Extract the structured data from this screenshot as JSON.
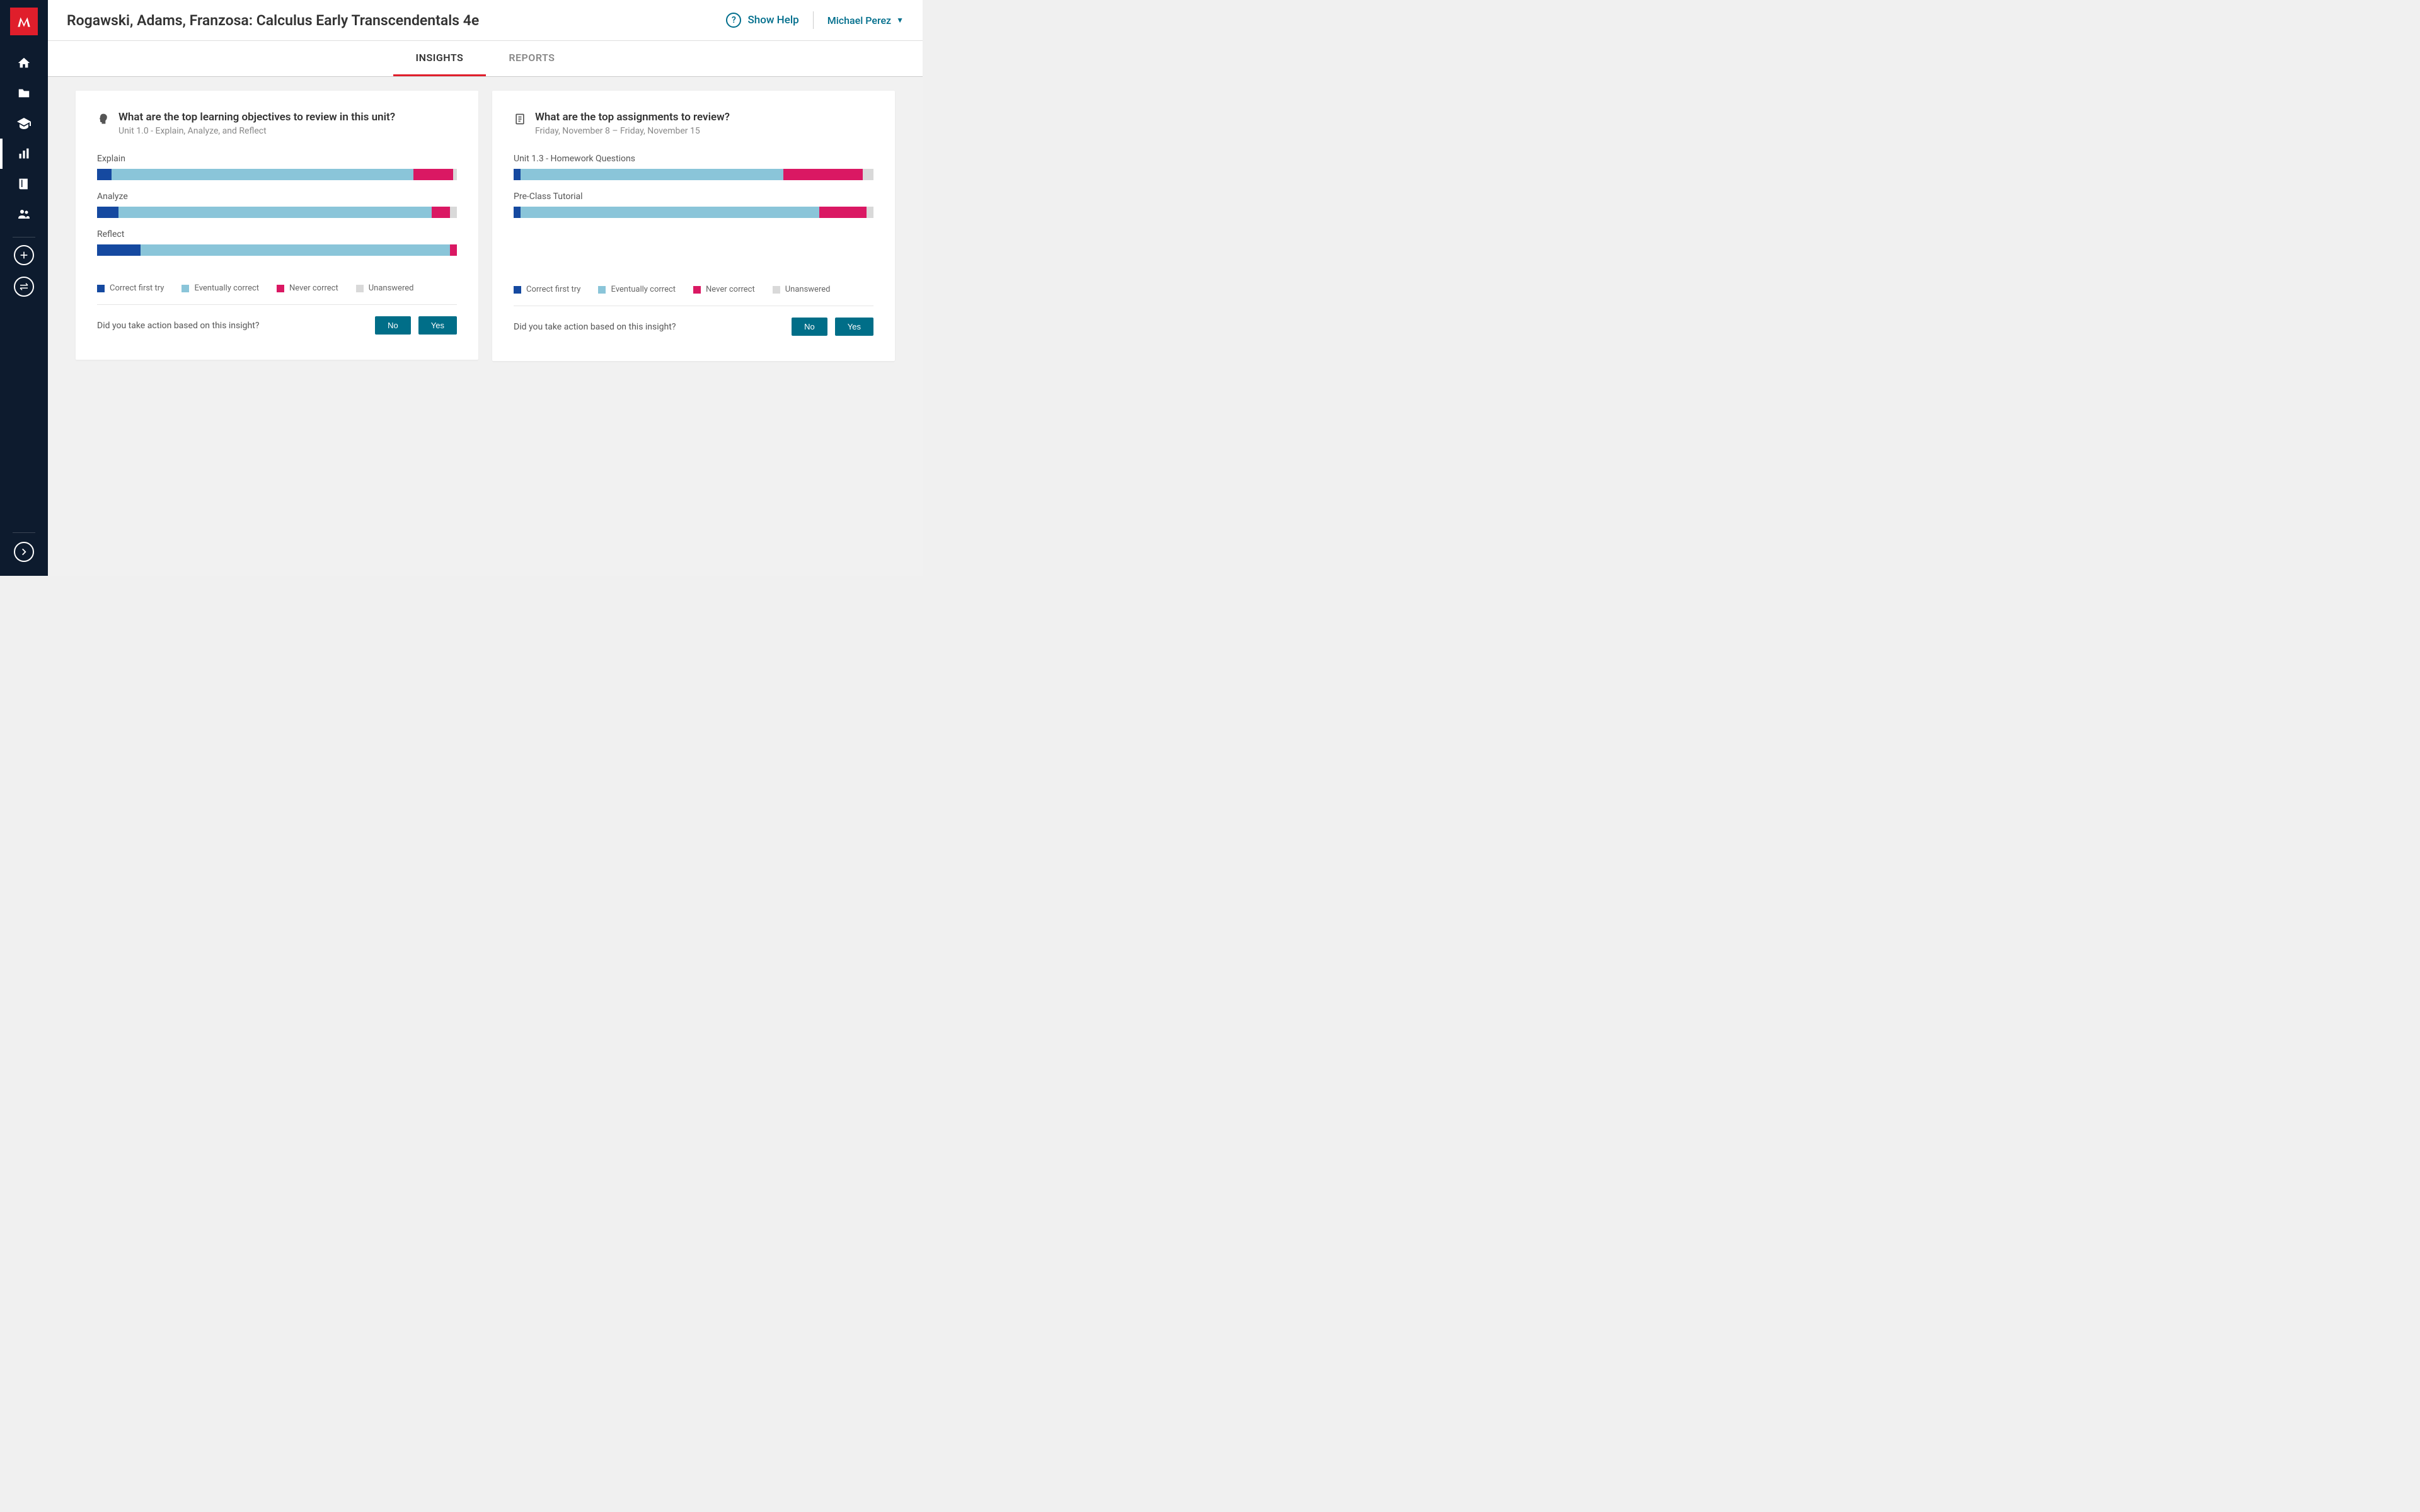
{
  "header": {
    "title": "Rogawski, Adams, Franzosa: Calculus Early Transcendentals 4e",
    "help_label": "Show Help",
    "user_name": "Michael Perez"
  },
  "tabs": {
    "insights": "INSIGHTS",
    "reports": "REPORTS"
  },
  "legend": {
    "correct": "Correct first try",
    "eventually": "Eventually correct",
    "never": "Never correct",
    "unanswered": "Unanswered"
  },
  "feedback": {
    "prompt": "Did you take action based on this insight?",
    "no": "No",
    "yes": "Yes"
  },
  "cards": {
    "objectives": {
      "title": "What are the top learning objectives to review in this unit?",
      "subtitle": "Unit 1.0 - Explain, Analyze, and Reflect",
      "bars": [
        {
          "label": "Explain"
        },
        {
          "label": "Analyze"
        },
        {
          "label": "Reflect"
        }
      ]
    },
    "assignments": {
      "title": "What are the top assignments to review?",
      "subtitle": "Friday, November 8 – Friday, November 15",
      "bars": [
        {
          "label": "Unit 1.3 - Homework Questions"
        },
        {
          "label": "Pre-Class Tutorial"
        }
      ]
    }
  },
  "chart_data": [
    {
      "type": "bar",
      "title": "What are the top learning objectives to review in this unit?",
      "orientation": "horizontal-stacked",
      "categories": [
        "Explain",
        "Analyze",
        "Reflect"
      ],
      "series": [
        {
          "name": "Correct first try",
          "values": [
            4,
            6,
            12
          ],
          "color": "#1549a0"
        },
        {
          "name": "Eventually correct",
          "values": [
            84,
            87,
            86
          ],
          "color": "#8ac5d9"
        },
        {
          "name": "Never correct",
          "values": [
            11,
            5,
            2
          ],
          "color": "#da1863"
        },
        {
          "name": "Unanswered",
          "values": [
            1,
            2,
            0
          ],
          "color": "#d9d9d9"
        }
      ],
      "xlim": [
        0,
        100
      ]
    },
    {
      "type": "bar",
      "title": "What are the top assignments to review?",
      "orientation": "horizontal-stacked",
      "categories": [
        "Unit 1.3 - Homework Questions",
        "Pre-Class Tutorial"
      ],
      "series": [
        {
          "name": "Correct first try",
          "values": [
            2,
            2
          ],
          "color": "#1549a0"
        },
        {
          "name": "Eventually correct",
          "values": [
            73,
            83
          ],
          "color": "#8ac5d9"
        },
        {
          "name": "Never correct",
          "values": [
            22,
            13
          ],
          "color": "#da1863"
        },
        {
          "name": "Unanswered",
          "values": [
            3,
            2
          ],
          "color": "#d9d9d9"
        }
      ],
      "xlim": [
        0,
        100
      ]
    }
  ]
}
